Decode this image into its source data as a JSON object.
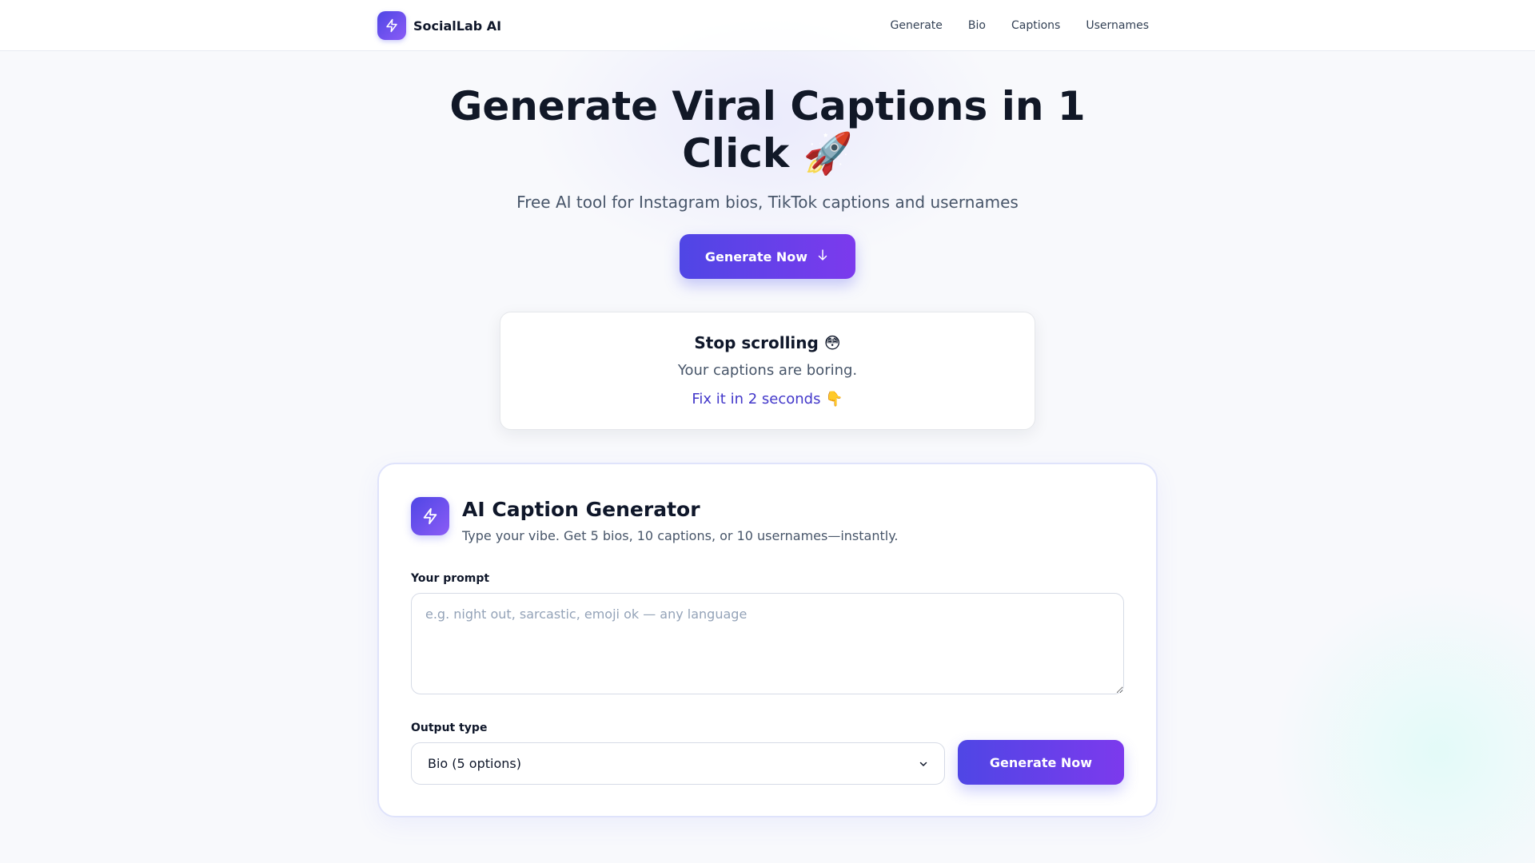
{
  "navbar": {
    "brand": "SocialLab AI",
    "links": [
      "Generate",
      "Bio",
      "Captions",
      "Usernames"
    ]
  },
  "hero": {
    "title": "Generate Viral Captions in 1 Click 🚀",
    "subtitle": "Free AI tool for Instagram bios, TikTok captions and usernames",
    "cta_label": "Generate Now"
  },
  "hook": {
    "title": "Stop scrolling 😳",
    "line": "Your captions are boring.",
    "cta": "Fix it in 2 seconds 👇"
  },
  "generator": {
    "title": "AI Caption Generator",
    "description": "Type your vibe. Get 5 bios, 10 captions, or 10 usernames—instantly.",
    "prompt_label": "Your prompt",
    "prompt_placeholder": "e.g. night out, sarcastic, emoji ok — any language",
    "prompt_value": "",
    "output_label": "Output type",
    "output_selected": "Bio (5 options)",
    "button_label": "Generate Now"
  },
  "colors": {
    "accent_start": "#4f46e5",
    "accent_end": "#7c3aed",
    "link": "#4338ca"
  },
  "icons": {
    "brand": "lightning-bolt-icon",
    "cta": "arrow-down-icon",
    "generator": "lightning-bolt-icon",
    "select": "chevron-down-icon"
  }
}
